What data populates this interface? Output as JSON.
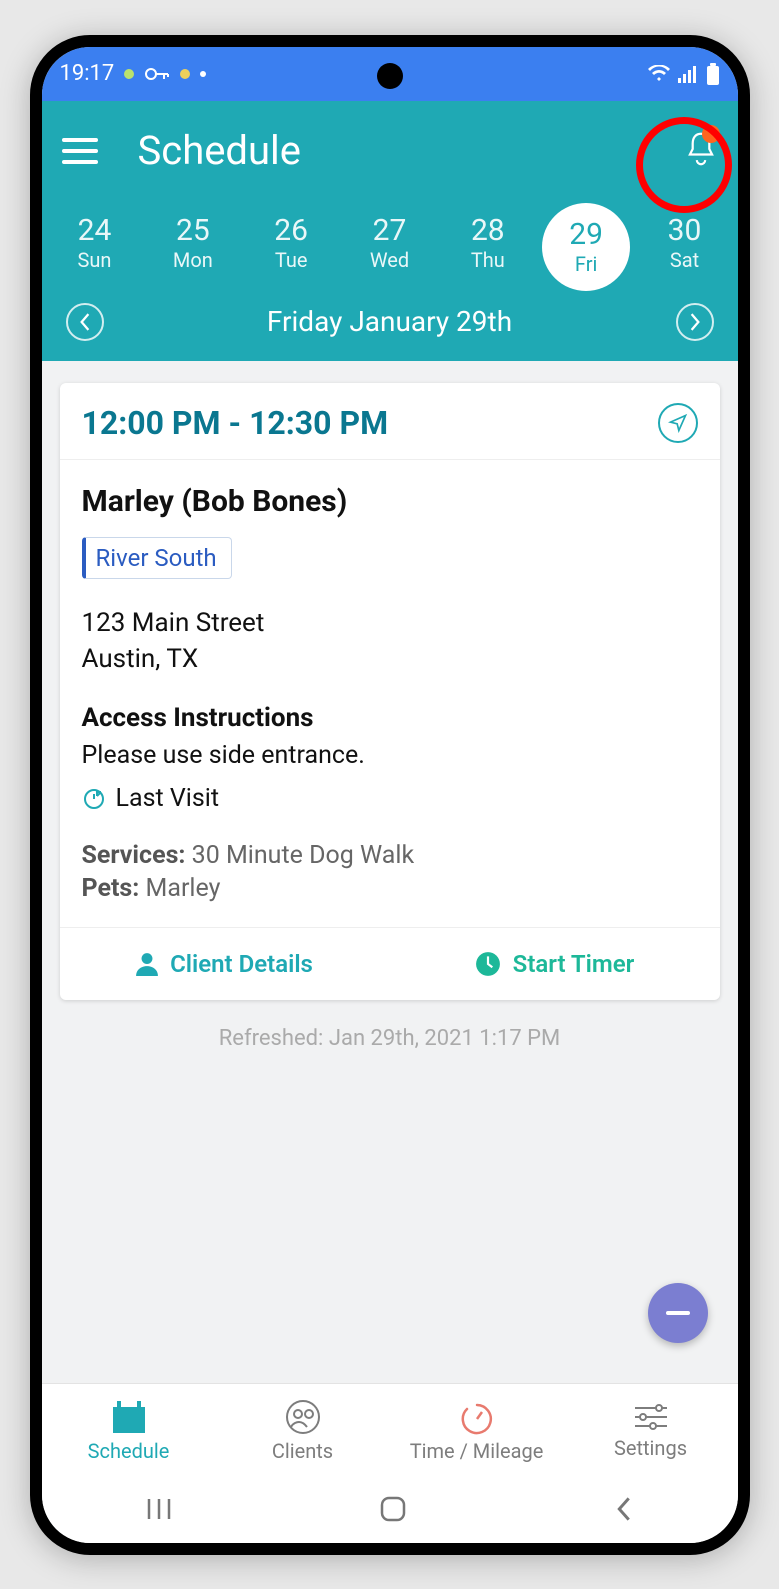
{
  "statusBar": {
    "time": "19:17"
  },
  "header": {
    "title": "Schedule"
  },
  "week": {
    "days": [
      {
        "num": "24",
        "name": "Sun"
      },
      {
        "num": "25",
        "name": "Mon"
      },
      {
        "num": "26",
        "name": "Tue"
      },
      {
        "num": "27",
        "name": "Wed"
      },
      {
        "num": "28",
        "name": "Thu"
      },
      {
        "num": "29",
        "name": "Fri"
      },
      {
        "num": "30",
        "name": "Sat"
      }
    ],
    "selectedIndex": 5,
    "currentDateLabel": "Friday January 29th"
  },
  "appointment": {
    "timeRange": "12:00 PM - 12:30 PM",
    "clientName": "Marley (Bob Bones)",
    "tag": "River South",
    "addressLine1": "123 Main Street",
    "addressLine2": "Austin, TX",
    "accessHeading": "Access Instructions",
    "accessText": "Please use side entrance.",
    "lastVisitLabel": "Last Visit",
    "servicesLabel": "Services:",
    "servicesValue": "30 Minute Dog Walk",
    "petsLabel": "Pets:",
    "petsValue": "Marley",
    "clientDetailsLabel": "Client Details",
    "startTimerLabel": "Start Timer"
  },
  "refreshed": "Refreshed: Jan 29th, 2021 1:17 PM",
  "tabs": {
    "schedule": "Schedule",
    "clients": "Clients",
    "timeMileage": "Time / Mileage",
    "settings": "Settings"
  }
}
